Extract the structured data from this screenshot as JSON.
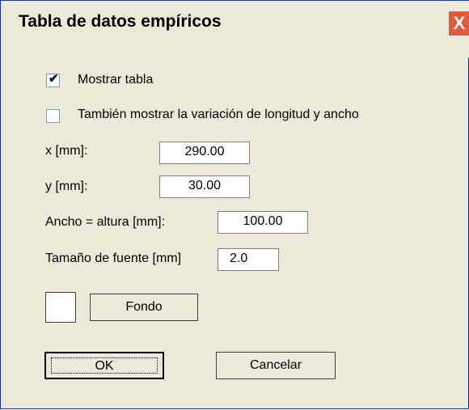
{
  "window": {
    "title": "Tabla de datos empíricos",
    "close_label": "X"
  },
  "options": {
    "show_table": {
      "label": "Mostrar tabla",
      "checked": true
    },
    "show_variation": {
      "label": "También mostrar la variación de longitud y ancho",
      "checked": false
    }
  },
  "fields": {
    "x": {
      "label": "x [mm]:",
      "value": "290.00"
    },
    "y": {
      "label": "y [mm]:",
      "value": "30.00"
    },
    "width_height": {
      "label": "Ancho = altura [mm]:",
      "value": "100.00"
    },
    "font_size": {
      "label": "Tamaño de fuente [mm]",
      "value": "2.0"
    }
  },
  "background": {
    "button_label": "Fondo",
    "color": "#ffffff"
  },
  "actions": {
    "ok_label": "OK",
    "cancel_label": "Cancelar"
  }
}
